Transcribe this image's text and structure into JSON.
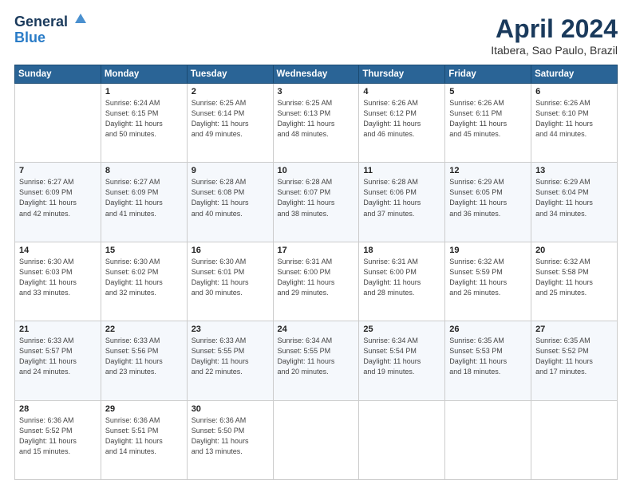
{
  "header": {
    "logo_line1": "General",
    "logo_line2": "Blue",
    "month": "April 2024",
    "location": "Itabera, Sao Paulo, Brazil"
  },
  "weekdays": [
    "Sunday",
    "Monday",
    "Tuesday",
    "Wednesday",
    "Thursday",
    "Friday",
    "Saturday"
  ],
  "weeks": [
    [
      {
        "num": "",
        "sunrise": "",
        "sunset": "",
        "daylight": ""
      },
      {
        "num": "1",
        "sunrise": "Sunrise: 6:24 AM",
        "sunset": "Sunset: 6:15 PM",
        "daylight": "Daylight: 11 hours and 50 minutes."
      },
      {
        "num": "2",
        "sunrise": "Sunrise: 6:25 AM",
        "sunset": "Sunset: 6:14 PM",
        "daylight": "Daylight: 11 hours and 49 minutes."
      },
      {
        "num": "3",
        "sunrise": "Sunrise: 6:25 AM",
        "sunset": "Sunset: 6:13 PM",
        "daylight": "Daylight: 11 hours and 48 minutes."
      },
      {
        "num": "4",
        "sunrise": "Sunrise: 6:26 AM",
        "sunset": "Sunset: 6:12 PM",
        "daylight": "Daylight: 11 hours and 46 minutes."
      },
      {
        "num": "5",
        "sunrise": "Sunrise: 6:26 AM",
        "sunset": "Sunset: 6:11 PM",
        "daylight": "Daylight: 11 hours and 45 minutes."
      },
      {
        "num": "6",
        "sunrise": "Sunrise: 6:26 AM",
        "sunset": "Sunset: 6:10 PM",
        "daylight": "Daylight: 11 hours and 44 minutes."
      }
    ],
    [
      {
        "num": "7",
        "sunrise": "Sunrise: 6:27 AM",
        "sunset": "Sunset: 6:09 PM",
        "daylight": "Daylight: 11 hours and 42 minutes."
      },
      {
        "num": "8",
        "sunrise": "Sunrise: 6:27 AM",
        "sunset": "Sunset: 6:09 PM",
        "daylight": "Daylight: 11 hours and 41 minutes."
      },
      {
        "num": "9",
        "sunrise": "Sunrise: 6:28 AM",
        "sunset": "Sunset: 6:08 PM",
        "daylight": "Daylight: 11 hours and 40 minutes."
      },
      {
        "num": "10",
        "sunrise": "Sunrise: 6:28 AM",
        "sunset": "Sunset: 6:07 PM",
        "daylight": "Daylight: 11 hours and 38 minutes."
      },
      {
        "num": "11",
        "sunrise": "Sunrise: 6:28 AM",
        "sunset": "Sunset: 6:06 PM",
        "daylight": "Daylight: 11 hours and 37 minutes."
      },
      {
        "num": "12",
        "sunrise": "Sunrise: 6:29 AM",
        "sunset": "Sunset: 6:05 PM",
        "daylight": "Daylight: 11 hours and 36 minutes."
      },
      {
        "num": "13",
        "sunrise": "Sunrise: 6:29 AM",
        "sunset": "Sunset: 6:04 PM",
        "daylight": "Daylight: 11 hours and 34 minutes."
      }
    ],
    [
      {
        "num": "14",
        "sunrise": "Sunrise: 6:30 AM",
        "sunset": "Sunset: 6:03 PM",
        "daylight": "Daylight: 11 hours and 33 minutes."
      },
      {
        "num": "15",
        "sunrise": "Sunrise: 6:30 AM",
        "sunset": "Sunset: 6:02 PM",
        "daylight": "Daylight: 11 hours and 32 minutes."
      },
      {
        "num": "16",
        "sunrise": "Sunrise: 6:30 AM",
        "sunset": "Sunset: 6:01 PM",
        "daylight": "Daylight: 11 hours and 30 minutes."
      },
      {
        "num": "17",
        "sunrise": "Sunrise: 6:31 AM",
        "sunset": "Sunset: 6:00 PM",
        "daylight": "Daylight: 11 hours and 29 minutes."
      },
      {
        "num": "18",
        "sunrise": "Sunrise: 6:31 AM",
        "sunset": "Sunset: 6:00 PM",
        "daylight": "Daylight: 11 hours and 28 minutes."
      },
      {
        "num": "19",
        "sunrise": "Sunrise: 6:32 AM",
        "sunset": "Sunset: 5:59 PM",
        "daylight": "Daylight: 11 hours and 26 minutes."
      },
      {
        "num": "20",
        "sunrise": "Sunrise: 6:32 AM",
        "sunset": "Sunset: 5:58 PM",
        "daylight": "Daylight: 11 hours and 25 minutes."
      }
    ],
    [
      {
        "num": "21",
        "sunrise": "Sunrise: 6:33 AM",
        "sunset": "Sunset: 5:57 PM",
        "daylight": "Daylight: 11 hours and 24 minutes."
      },
      {
        "num": "22",
        "sunrise": "Sunrise: 6:33 AM",
        "sunset": "Sunset: 5:56 PM",
        "daylight": "Daylight: 11 hours and 23 minutes."
      },
      {
        "num": "23",
        "sunrise": "Sunrise: 6:33 AM",
        "sunset": "Sunset: 5:55 PM",
        "daylight": "Daylight: 11 hours and 22 minutes."
      },
      {
        "num": "24",
        "sunrise": "Sunrise: 6:34 AM",
        "sunset": "Sunset: 5:55 PM",
        "daylight": "Daylight: 11 hours and 20 minutes."
      },
      {
        "num": "25",
        "sunrise": "Sunrise: 6:34 AM",
        "sunset": "Sunset: 5:54 PM",
        "daylight": "Daylight: 11 hours and 19 minutes."
      },
      {
        "num": "26",
        "sunrise": "Sunrise: 6:35 AM",
        "sunset": "Sunset: 5:53 PM",
        "daylight": "Daylight: 11 hours and 18 minutes."
      },
      {
        "num": "27",
        "sunrise": "Sunrise: 6:35 AM",
        "sunset": "Sunset: 5:52 PM",
        "daylight": "Daylight: 11 hours and 17 minutes."
      }
    ],
    [
      {
        "num": "28",
        "sunrise": "Sunrise: 6:36 AM",
        "sunset": "Sunset: 5:52 PM",
        "daylight": "Daylight: 11 hours and 15 minutes."
      },
      {
        "num": "29",
        "sunrise": "Sunrise: 6:36 AM",
        "sunset": "Sunset: 5:51 PM",
        "daylight": "Daylight: 11 hours and 14 minutes."
      },
      {
        "num": "30",
        "sunrise": "Sunrise: 6:36 AM",
        "sunset": "Sunset: 5:50 PM",
        "daylight": "Daylight: 11 hours and 13 minutes."
      },
      {
        "num": "",
        "sunrise": "",
        "sunset": "",
        "daylight": ""
      },
      {
        "num": "",
        "sunrise": "",
        "sunset": "",
        "daylight": ""
      },
      {
        "num": "",
        "sunrise": "",
        "sunset": "",
        "daylight": ""
      },
      {
        "num": "",
        "sunrise": "",
        "sunset": "",
        "daylight": ""
      }
    ]
  ]
}
